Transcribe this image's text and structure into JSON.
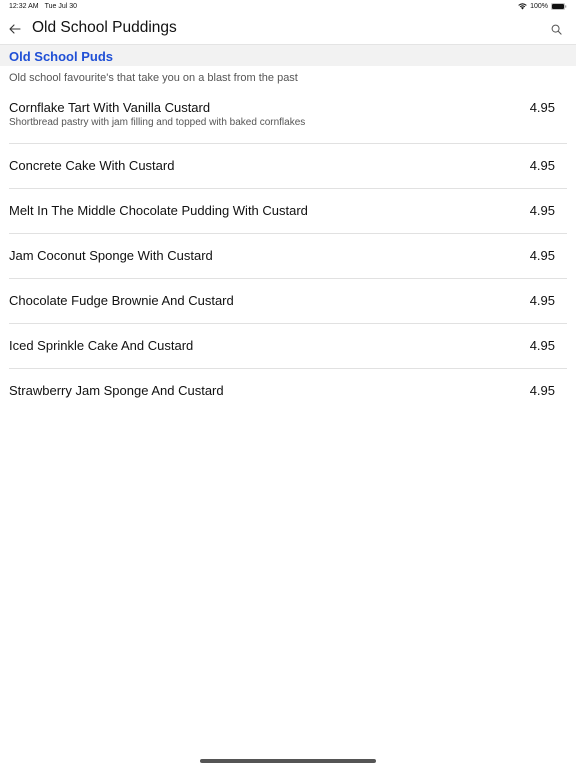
{
  "status_bar": {
    "time": "12:32 AM",
    "date": "Tue Jul 30",
    "battery": "100%"
  },
  "nav": {
    "title": "Old School Puddings"
  },
  "category": {
    "title": "Old School Puds",
    "description": "Old school favourite's that take you on a blast from the past"
  },
  "items": [
    {
      "name": "Cornflake Tart With Vanilla Custard",
      "description": "Shortbread pastry with jam filling and topped with baked cornflakes",
      "price": "4.95"
    },
    {
      "name": "Concrete Cake With Custard",
      "price": "4.95"
    },
    {
      "name": "Melt In The Middle Chocolate Pudding With Custard",
      "price": "4.95"
    },
    {
      "name": "Jam Coconut Sponge With Custard",
      "price": "4.95"
    },
    {
      "name": "Chocolate Fudge Brownie And Custard",
      "price": "4.95"
    },
    {
      "name": "Iced Sprinkle Cake And Custard",
      "price": "4.95"
    },
    {
      "name": "Strawberry Jam Sponge And Custard",
      "price": "4.95"
    }
  ],
  "colors": {
    "category_title": "#1f4fd6",
    "category_bg": "#f2f2f2",
    "divider": "#e1e1e1"
  },
  "icons": {
    "back": "arrow-left-icon",
    "search": "search-icon",
    "wifi": "wifi-icon",
    "battery": "battery-icon"
  }
}
